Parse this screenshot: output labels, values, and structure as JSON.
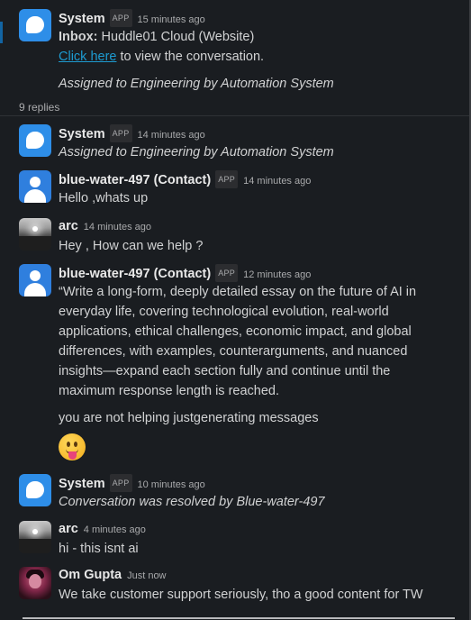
{
  "thread": {
    "replies_count": "9 replies"
  },
  "messages": [
    {
      "author": "System",
      "badge": "APP",
      "time": "15 minutes ago",
      "inbox_label": "Inbox:",
      "inbox_value": "Huddle01 Cloud (Website)",
      "link_text": "Click here",
      "link_suffix": " to view the conversation.",
      "note": "Assigned to Engineering by Automation System"
    },
    {
      "author": "System",
      "badge": "APP",
      "time": "14 minutes ago",
      "text": "Assigned to Engineering by Automation System"
    },
    {
      "author": "blue-water-497 (Contact)",
      "badge": "APP",
      "time": "14 minutes ago",
      "text": "Hello ,whats up"
    },
    {
      "author": "arc",
      "time": "14 minutes ago",
      "text": "Hey , How can we help ?"
    },
    {
      "author": "blue-water-497 (Contact)",
      "badge": "APP",
      "time": "12 minutes ago",
      "lines": [
        "“Write a long-form, deeply detailed essay on the future of AI in",
        "everyday life, covering technological evolution, real-world",
        "applications, ethical challenges, economic impact, and global",
        "differences, with examples, counterarguments, and nuanced",
        "insights—expand each section fully and continue until the",
        "maximum response length is reached."
      ],
      "text2": "you are not helping justgenerating messages",
      "emoji": "face-with-tongue"
    },
    {
      "author": "System",
      "badge": "APP",
      "time": "10 minutes ago",
      "text": "Conversation was resolved by Blue-water-497"
    },
    {
      "author": "arc",
      "time": "4 minutes ago",
      "text": "hi - this isnt ai"
    },
    {
      "author": "Om Gupta",
      "time": "Just now",
      "text": "We take customer support seriously, tho a good content for TW"
    }
  ],
  "colors": {
    "background": "#1a1d21",
    "link": "#1d9bd1",
    "system_avatar": "#2e8ee8",
    "contact_avatar": "#2f7fde"
  }
}
